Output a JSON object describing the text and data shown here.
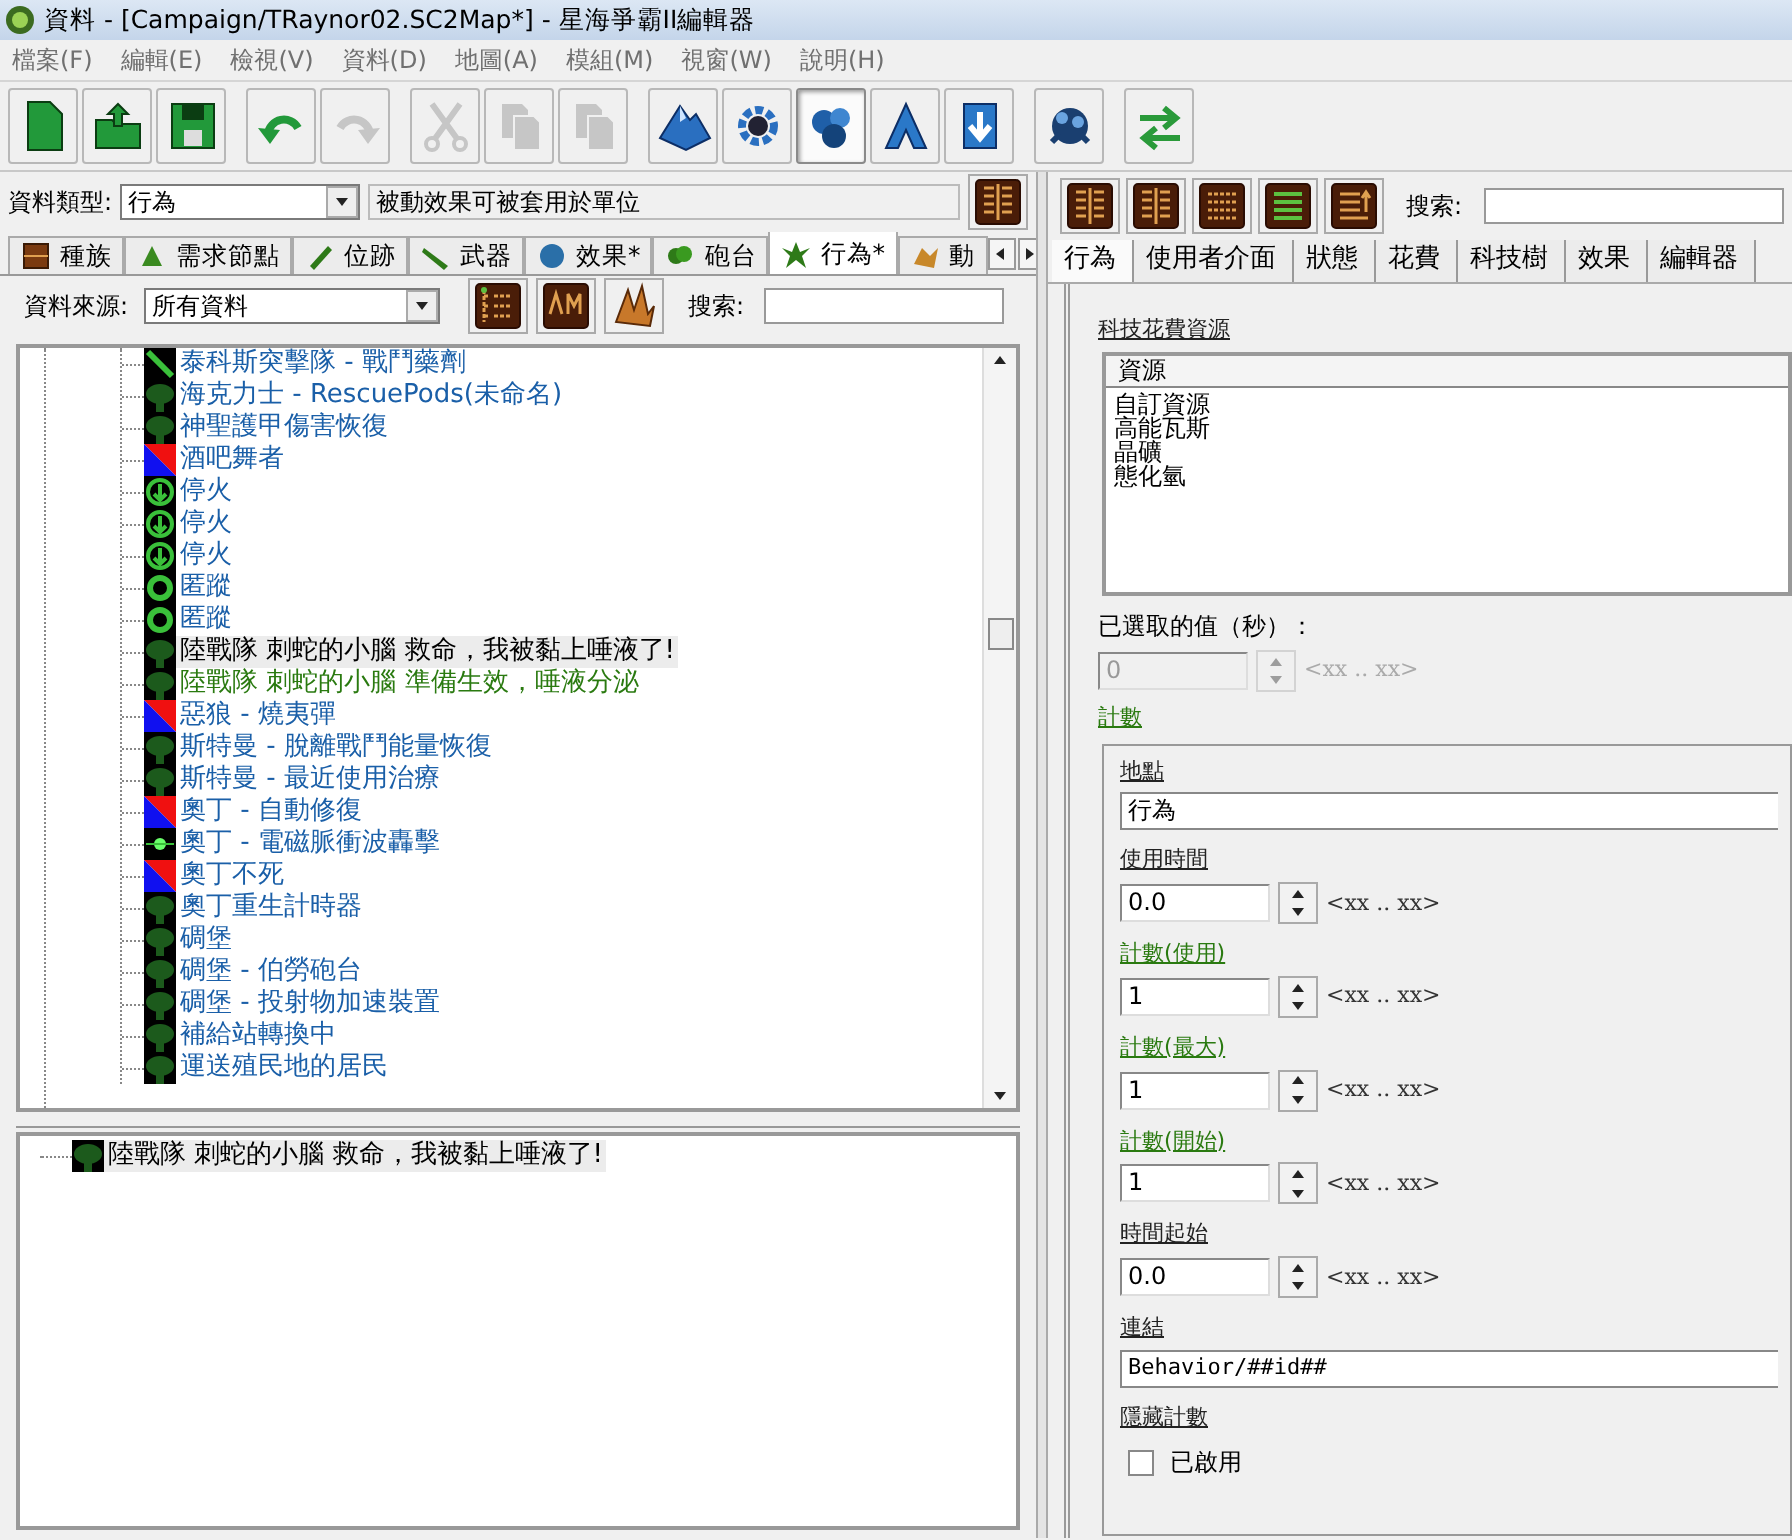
{
  "window": {
    "title": "資料 - [Campaign/TRaynor02.SC2Map*] - 星海爭霸II編輯器"
  },
  "menu": [
    "檔案(F)",
    "編輯(E)",
    "檢視(V)",
    "資料(D)",
    "地圖(A)",
    "模組(M)",
    "視窗(W)",
    "說明(H)"
  ],
  "toolbar": [
    [
      {
        "kind": "new",
        "disabled": false,
        "pressed": false
      },
      {
        "kind": "open",
        "disabled": false,
        "pressed": false
      },
      {
        "kind": "save",
        "disabled": false,
        "pressed": false
      }
    ],
    [
      {
        "kind": "undo",
        "disabled": false,
        "pressed": false
      },
      {
        "kind": "redo",
        "disabled": true,
        "pressed": false
      }
    ],
    [
      {
        "kind": "cut",
        "disabled": true,
        "pressed": false
      },
      {
        "kind": "copy",
        "disabled": true,
        "pressed": false
      },
      {
        "kind": "paste",
        "disabled": true,
        "pressed": false
      }
    ],
    [
      {
        "kind": "terrain",
        "disabled": false,
        "pressed": false
      },
      {
        "kind": "gear",
        "disabled": false,
        "pressed": false
      },
      {
        "kind": "data",
        "disabled": false,
        "pressed": true
      },
      {
        "kind": "triangle",
        "disabled": false,
        "pressed": false
      },
      {
        "kind": "import",
        "disabled": false,
        "pressed": false
      }
    ],
    [
      {
        "kind": "creature",
        "disabled": false,
        "pressed": false
      }
    ],
    [
      {
        "kind": "exchange",
        "disabled": false,
        "pressed": false
      }
    ]
  ],
  "data_type": {
    "label": "資料類型:",
    "value": "行為",
    "description": "被動效果可被套用於單位"
  },
  "tabs": [
    {
      "label": "種族",
      "kind": "block",
      "selected": false
    },
    {
      "label": "需求節點",
      "kind": "bug",
      "selected": false
    },
    {
      "label": "位跡",
      "kind": "shoe",
      "selected": false
    },
    {
      "label": "武器",
      "kind": "gun",
      "selected": false
    },
    {
      "label": "效果*",
      "kind": "splash",
      "selected": false
    },
    {
      "label": "砲台",
      "kind": "leaf",
      "selected": false
    },
    {
      "label": "行為*",
      "kind": "figure",
      "selected": true
    },
    {
      "label": "動",
      "kind": "beast",
      "selected": false
    }
  ],
  "source": {
    "label": "資料來源:",
    "value": "所有資料",
    "search_label": "搜索:"
  },
  "tree": [
    {
      "label": "泰科斯突擊隊 - 戰鬥藥劑",
      "kind": "sword",
      "selected": false,
      "modified": false
    },
    {
      "label": "海克力士 - RescuePods(未命名)",
      "kind": "blob",
      "selected": false,
      "modified": false
    },
    {
      "label": "神聖護甲傷害恢復",
      "kind": "blob",
      "selected": false,
      "modified": false
    },
    {
      "label": "酒吧舞者",
      "kind": "split",
      "selected": false,
      "modified": false
    },
    {
      "label": "停火",
      "kind": "stop",
      "selected": false,
      "modified": false
    },
    {
      "label": "停火",
      "kind": "stop",
      "selected": false,
      "modified": false
    },
    {
      "label": "停火",
      "kind": "stop",
      "selected": false,
      "modified": false
    },
    {
      "label": "匿蹤",
      "kind": "ring",
      "selected": false,
      "modified": false
    },
    {
      "label": "匿蹤",
      "kind": "ring",
      "selected": false,
      "modified": false
    },
    {
      "label": "陸戰隊 刺蛇的小腦 救命，我被黏上唾液了!",
      "kind": "blob",
      "selected": true,
      "modified": false
    },
    {
      "label": "陸戰隊 刺蛇的小腦 準備生效，唾液分泌",
      "kind": "blob",
      "selected": false,
      "modified": true
    },
    {
      "label": "惡狼 - 燒夷彈",
      "kind": "split",
      "selected": false,
      "modified": false
    },
    {
      "label": "斯特曼 - 脫離戰鬥能量恢復",
      "kind": "blob",
      "selected": false,
      "modified": false
    },
    {
      "label": "斯特曼 - 最近使用治療",
      "kind": "blob",
      "selected": false,
      "modified": false
    },
    {
      "label": "奧丁 - 自動修復",
      "kind": "split",
      "selected": false,
      "modified": false
    },
    {
      "label": "奧丁 - 電磁脈衝波轟擊",
      "kind": "star",
      "selected": false,
      "modified": false
    },
    {
      "label": "奧丁不死",
      "kind": "split",
      "selected": false,
      "modified": false
    },
    {
      "label": "奧丁重生計時器",
      "kind": "blob",
      "selected": false,
      "modified": false
    },
    {
      "label": "碉堡",
      "kind": "blob",
      "selected": false,
      "modified": false
    },
    {
      "label": "碉堡 - 伯勞砲台",
      "kind": "blob",
      "selected": false,
      "modified": false
    },
    {
      "label": "碉堡 - 投射物加速裝置",
      "kind": "blob",
      "selected": false,
      "modified": false
    },
    {
      "label": "補給站轉換中",
      "kind": "blob",
      "selected": false,
      "modified": false
    },
    {
      "label": "運送殖民地的居民",
      "kind": "blob",
      "selected": false,
      "modified": false
    }
  ],
  "preview": {
    "label": "陸戰隊 刺蛇的小腦 救命，我被黏上唾液了!",
    "kind": "blob"
  },
  "right": {
    "tools": [
      {
        "kind": "columns"
      },
      {
        "kind": "columns"
      },
      {
        "kind": "grid"
      },
      {
        "kind": "green-lines"
      },
      {
        "kind": "arrow-lines"
      }
    ],
    "search_label": "搜索:",
    "tabs": [
      {
        "label": "行為",
        "selected": true
      },
      {
        "label": "使用者介面",
        "selected": false
      },
      {
        "label": "狀態",
        "selected": false
      },
      {
        "label": "花費",
        "selected": false
      },
      {
        "label": "科技樹",
        "selected": false
      },
      {
        "label": "效果",
        "selected": false
      },
      {
        "label": "編輯器",
        "selected": false
      }
    ],
    "cost_resources": {
      "label": "科技花費資源",
      "header": "資源",
      "items": [
        "自訂資源",
        "高能瓦斯",
        "晶礦",
        "態化氫"
      ]
    },
    "selected_value": {
      "label": "已選取的值（秒）：",
      "value": "0",
      "range": "<xx .. xx>",
      "disabled": true
    },
    "counter": {
      "label": "計數",
      "modified": true,
      "fields": [
        {
          "kind": "text",
          "label": "地點",
          "value": "行為",
          "modified": false
        },
        {
          "kind": "spin",
          "label": "使用時間",
          "value": "0.0",
          "range": "<xx .. xx>",
          "modified": false
        },
        {
          "kind": "spin",
          "label": "計數(使用)",
          "value": "1",
          "range": "<xx .. xx>",
          "modified": true
        },
        {
          "kind": "spin",
          "label": "計數(最大)",
          "value": "1",
          "range": "<xx .. xx>",
          "modified": true
        },
        {
          "kind": "spin",
          "label": "計數(開始)",
          "value": "1",
          "range": "<xx .. xx>",
          "modified": true
        },
        {
          "kind": "spin",
          "label": "時間起始",
          "value": "0.0",
          "range": "<xx .. xx>",
          "modified": false
        },
        {
          "kind": "text",
          "label": "連結",
          "value": "Behavior/##id##",
          "modified": false
        },
        {
          "kind": "checkbox",
          "label": "隱藏計數",
          "option": "已啟用",
          "checked": false,
          "modified": false
        }
      ]
    }
  }
}
